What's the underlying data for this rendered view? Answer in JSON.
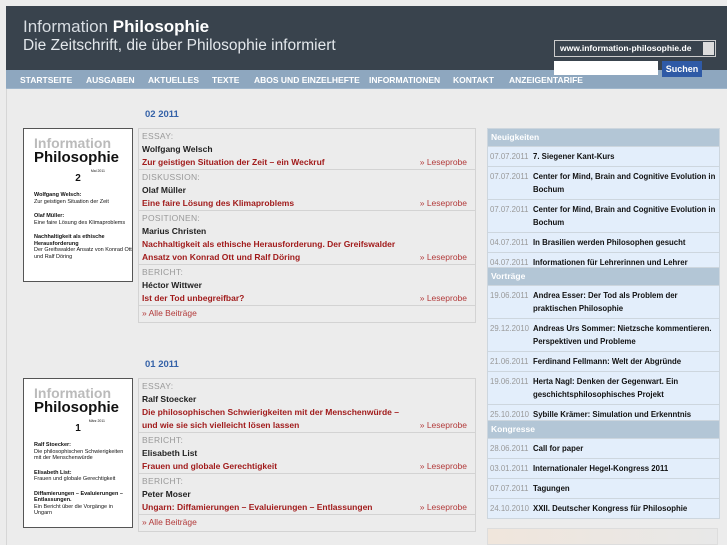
{
  "header": {
    "brand_light": "Information",
    "brand_bold": "Philosophie",
    "tagline": "Die Zeitschrift, die über Philosophie informiert",
    "site_select": "www.information-philosophie.de",
    "search_placeholder": "",
    "search_button": "Suchen"
  },
  "nav": [
    "STARTSEITE",
    "AUSGABEN",
    "AKTUELLES",
    "TEXTE",
    "ABOS UND EINZELHEFTE",
    "INFORMATIONEN",
    "KONTAKT",
    "ANZEIGENTARIFE"
  ],
  "issues": [
    {
      "title": "02 2011",
      "cover": {
        "brand_light": "Information",
        "brand_bold": "Philosophie",
        "date": "Mai 2011",
        "number": "2",
        "lines": [
          [
            "Wolfgang Welsch:",
            "Zur geistigen Situation der Zeit"
          ],
          [
            "Olaf Müller:",
            "Eine faire Lösung des Klimaproblems"
          ],
          [
            "Nachhaltigkeit als ethische Herausforderung",
            "Der Greifswalder Ansatz von Konrad Ott und Ralf Döring"
          ]
        ]
      },
      "articles": [
        {
          "category": "ESSAY:",
          "author": "Wolfgang Welsch",
          "title": "Zur geistigen Situation der Zeit – ein Weckruf",
          "link": "» Leseprobe"
        },
        {
          "category": "DISKUSSION:",
          "author": "Olaf Müller",
          "title": "Eine faire Lösung des Klimaproblems",
          "link": "» Leseprobe"
        },
        {
          "category": "POSITIONEN:",
          "author": "Marius Christen",
          "title": "Nachhaltigkeit als ethische Herausforderung. Der Greifswalder Ansatz von Konrad Ott und Ralf Döring",
          "link": "» Leseprobe"
        },
        {
          "category": "BERICHT:",
          "author": "Héctor Wittwer",
          "title": "Ist der Tod unbegreifbar?",
          "link": "» Leseprobe"
        }
      ],
      "all_link": "» Alle Beiträge"
    },
    {
      "title": "01 2011",
      "cover": {
        "brand_light": "Information",
        "brand_bold": "Philosophie",
        "date": "März 2011",
        "number": "1",
        "lines": [
          [
            "Ralf Stoecker:",
            "Die philosophischen Schwierigkeiten mit der Menschenwürde"
          ],
          [
            "Elisabeth List:",
            "Frauen und globale Gerechtigkeit"
          ],
          [
            "Diffamierungen – Evaluierungen – Entlassungen.",
            "Ein Bericht über die Vorgänge in Ungarn"
          ]
        ]
      },
      "articles": [
        {
          "category": "ESSAY:",
          "author": "Ralf Stoecker",
          "title": "Die philosophischen Schwierigkeiten mit der Menschenwürde – und wie sie sich vielleicht lösen lassen",
          "link": "» Leseprobe"
        },
        {
          "category": "BERICHT:",
          "author": "Elisabeth List",
          "title": "Frauen und globale Gerechtigkeit",
          "link": "» Leseprobe"
        },
        {
          "category": "BERICHT:",
          "author": "Peter Moser",
          "title": "Ungarn: Diffamierungen – Evaluierungen – Entlassungen",
          "link": "» Leseprobe"
        }
      ],
      "all_link": "» Alle Beiträge"
    }
  ],
  "sidebar": [
    {
      "title": "Neuigkeiten",
      "items": [
        {
          "date": "07.07.2011",
          "text": "7. Siegener Kant-Kurs"
        },
        {
          "date": "07.07.2011",
          "text": "Center for Mind, Brain and Cognitive Evolution in Bochum"
        },
        {
          "date": "07.07.2011",
          "text": "Center for Mind, Brain and Cognitive Evolution in Bochum"
        },
        {
          "date": "04.07.2011",
          "text": "In Brasilien werden Philosophen gesucht"
        },
        {
          "date": "04.07.2011",
          "text": "Informationen für Lehrerinnen und Lehrer"
        }
      ]
    },
    {
      "title": "Vorträge",
      "items": [
        {
          "date": "19.06.2011",
          "text": "Andrea Esser: Der Tod als Problem der praktischen Philosophie"
        },
        {
          "date": "29.12.2010",
          "text": "Andreas Urs Sommer: Nietzsche kommentieren. Perspektiven und Probleme"
        },
        {
          "date": "21.06.2011",
          "text": "Ferdinand Fellmann: Welt der Abgründe"
        },
        {
          "date": "19.06.2011",
          "text": "Herta Nagl: Denken der Gegenwart. Ein geschichtsphilosophisches Projekt"
        },
        {
          "date": "25.10.2010",
          "text": "Sybille Krämer: Simulation und Erkenntnis"
        }
      ]
    },
    {
      "title": "Kongresse",
      "items": [
        {
          "date": "28.06.2011",
          "text": "Call for paper"
        },
        {
          "date": "03.01.2011",
          "text": "Internationaler Hegel-Kongress 2011"
        },
        {
          "date": "07.07.2011",
          "text": "Tagungen"
        },
        {
          "date": "24.10.2010",
          "text": "XXII. Deutscher Kongress für Philosophie"
        }
      ]
    }
  ]
}
